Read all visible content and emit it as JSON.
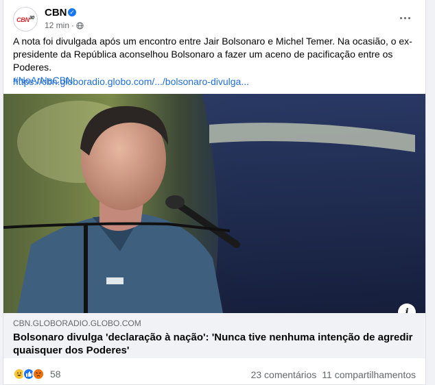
{
  "page": {
    "name": "CBN",
    "logo_text": "CBN",
    "logo_sup": "30",
    "verified_mark": "✓",
    "time": "12 min",
    "separator": "·"
  },
  "post": {
    "text": "A nota foi divulgada após um encontro entre Jair Bolsonaro e Michel Temer. Na ocasião, o ex-presidente da República aconselhou Bolsonaro a fazer um aceno de pacificação entre os Poderes.",
    "hashtag": "#NoArNaCBN",
    "link": "https://cbn.globoradio.globo.com/.../bolsonaro-divulga..."
  },
  "preview": {
    "domain": "CBN.GLOBORADIO.GLOBO.COM",
    "headline": "Bolsonaro divulga 'declaração à nação': 'Nunca tive nenhuma intenção de agredir quaisquer dos Poderes'",
    "info_icon": "i"
  },
  "footer": {
    "reaction_count": "58",
    "comments": "23 comentários",
    "shares": "11 compartilhamentos"
  },
  "colors": {
    "link": "#216fdb",
    "brand_red": "#d2232a",
    "fb_blue": "#1877f2",
    "muted": "#65676b"
  },
  "icons": {
    "verified": "verified-badge-icon",
    "globe": "globe-icon",
    "more": "more-options-icon",
    "info": "info-icon",
    "reactions": [
      "haha-reaction-icon",
      "like-reaction-icon",
      "angry-reaction-icon"
    ]
  }
}
